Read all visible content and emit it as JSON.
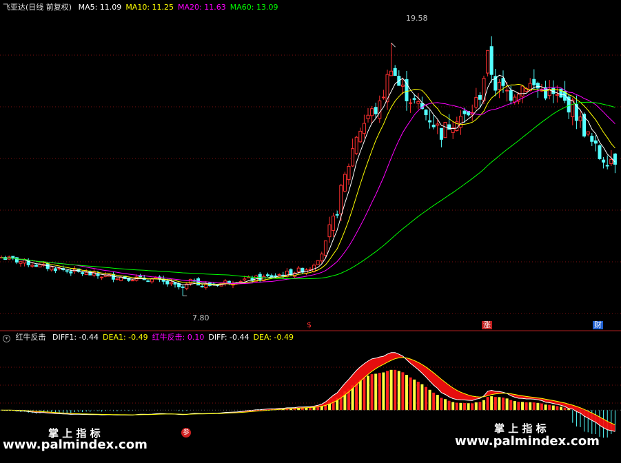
{
  "main_panel": {
    "title": "飞亚达(日线 前复权)",
    "indicators": [
      {
        "label": "MA5: 11.09",
        "color": "#ffffff"
      },
      {
        "label": "MA10: 11.25",
        "color": "#ffff00"
      },
      {
        "label": "MA20: 11.63",
        "color": "#ff00ff"
      },
      {
        "label": "MA60: 13.09",
        "color": "#00ff00"
      }
    ],
    "high_label": "19.58",
    "low_label": "7.80",
    "event_badges": [
      {
        "text": "$",
        "color": "#ff3030",
        "bg": "transparent"
      },
      {
        "text": "涨",
        "color": "#ffffff",
        "bg": "#c02020"
      },
      {
        "text": "财",
        "color": "#ffffff",
        "bg": "#2060d0"
      }
    ]
  },
  "sub_panel": {
    "title": "红牛反击",
    "indicators": [
      {
        "label": "DIFF1: -0.44",
        "color": "#ffffff"
      },
      {
        "label": "DEA1: -0.49",
        "color": "#ffff00"
      },
      {
        "label": "红牛反击: 0.10",
        "color": "#ff00ff"
      },
      {
        "label": "DIFF: -0.44",
        "color": "#ffffff"
      },
      {
        "label": "DEA: -0.49",
        "color": "#ffff00"
      }
    ],
    "signal_badge": "参"
  },
  "watermark": {
    "title": "掌 上 指 标",
    "url": "www.palmindex.com"
  },
  "chart_data": [
    {
      "type": "candlestick",
      "title": "飞亚达(日线 前复权)",
      "ylim": [
        6.5,
        21
      ],
      "n_bars": 160,
      "annotations": [
        {
          "text": "19.58",
          "value": 19.58
        },
        {
          "text": "7.80",
          "value": 7.8
        }
      ],
      "price_path": [
        [
          0,
          9.6
        ],
        [
          10,
          9.2
        ],
        [
          25,
          8.75
        ],
        [
          40,
          8.55
        ],
        [
          47,
          8.15
        ],
        [
          50,
          8.6
        ],
        [
          52,
          8.25
        ],
        [
          60,
          8.5
        ],
        [
          68,
          8.65
        ],
        [
          74,
          8.85
        ],
        [
          80,
          9.1
        ],
        [
          83,
          9.8
        ],
        [
          86,
          11.2
        ],
        [
          89,
          13.3
        ],
        [
          92,
          15.3
        ],
        [
          95,
          16.2
        ],
        [
          98,
          16.6
        ],
        [
          101,
          18.6
        ],
        [
          103,
          17.6
        ],
        [
          107,
          16.8
        ],
        [
          111,
          16.1
        ],
        [
          114,
          15.4
        ],
        [
          118,
          16.2
        ],
        [
          121,
          16.1
        ],
        [
          124,
          17.2
        ],
        [
          126,
          18.9
        ],
        [
          128,
          17.6
        ],
        [
          132,
          17.2
        ],
        [
          136,
          17.7
        ],
        [
          140,
          17.4
        ],
        [
          144,
          17.0
        ],
        [
          148,
          16.6
        ],
        [
          152,
          15.2
        ],
        [
          155,
          14.3
        ],
        [
          159,
          14.2
        ]
      ],
      "series": [
        {
          "name": "MA5",
          "color": "#ffffff",
          "last": 11.09
        },
        {
          "name": "MA10",
          "color": "#ffff00",
          "last": 11.25
        },
        {
          "name": "MA20",
          "color": "#ff00ff",
          "last": 11.63
        },
        {
          "name": "MA60",
          "color": "#00ff00",
          "last": 13.09
        }
      ]
    },
    {
      "type": "bar",
      "title": "红牛反击",
      "ylim": [
        -0.7,
        1.0
      ],
      "series": [
        {
          "name": "DIFF1",
          "color": "#ffffff",
          "last": -0.44
        },
        {
          "name": "DEA1",
          "color": "#ffff00",
          "last": -0.49
        },
        {
          "name": "红牛反击",
          "color": "#ff00ff",
          "last": 0.1
        },
        {
          "name": "DIFF",
          "color": "#ffffff",
          "last": -0.44
        },
        {
          "name": "DEA",
          "color": "#ffff00",
          "last": -0.49
        }
      ]
    }
  ]
}
